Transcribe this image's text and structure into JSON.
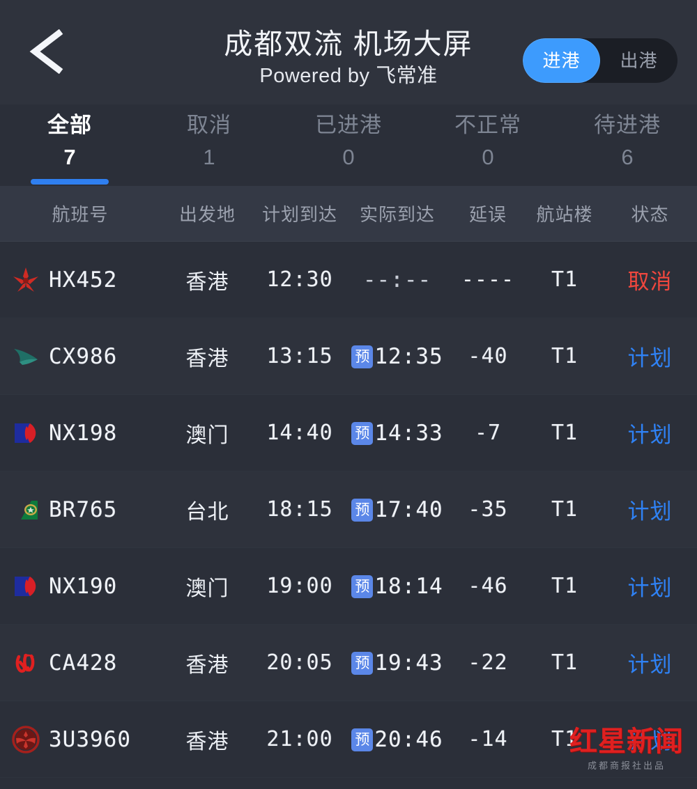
{
  "header": {
    "back_icon": "chevron-left-icon",
    "title": "成都双流 机场大屏",
    "subtitle": "Powered by 飞常准",
    "toggle": {
      "arrival_label": "进港",
      "departure_label": "出港",
      "selected": "进港",
      "active_color": "#3d9bfd"
    }
  },
  "tabs": [
    {
      "label": "全部",
      "count": "7",
      "active": true
    },
    {
      "label": "取消",
      "count": "1",
      "active": false
    },
    {
      "label": "已进港",
      "count": "0",
      "active": false
    },
    {
      "label": "不正常",
      "count": "0",
      "active": false
    },
    {
      "label": "待进港",
      "count": "6",
      "active": false
    }
  ],
  "table": {
    "columns": [
      "航班号",
      "出发地",
      "计划到达",
      "实际到达",
      "延误",
      "航站楼",
      "状态"
    ],
    "estimate_badge": "预",
    "rows": [
      {
        "logo": "hong-kong-airlines-logo",
        "flight": "HX452",
        "origin": "香港",
        "scheduled": "12:30",
        "actual": "--:--",
        "actual_estimated": false,
        "delay": "----",
        "terminal": "T1",
        "status": "取消",
        "status_type": "cancelled"
      },
      {
        "logo": "cathay-pacific-logo",
        "flight": "CX986",
        "origin": "香港",
        "scheduled": "13:15",
        "actual": "12:35",
        "actual_estimated": true,
        "delay": "-40",
        "terminal": "T1",
        "status": "计划",
        "status_type": "planned"
      },
      {
        "logo": "air-macau-logo",
        "flight": "NX198",
        "origin": "澳门",
        "scheduled": "14:40",
        "actual": "14:33",
        "actual_estimated": true,
        "delay": "-7",
        "terminal": "T1",
        "status": "计划",
        "status_type": "planned"
      },
      {
        "logo": "eva-air-logo",
        "flight": "BR765",
        "origin": "台北",
        "scheduled": "18:15",
        "actual": "17:40",
        "actual_estimated": true,
        "delay": "-35",
        "terminal": "T1",
        "status": "计划",
        "status_type": "planned"
      },
      {
        "logo": "air-macau-logo",
        "flight": "NX190",
        "origin": "澳门",
        "scheduled": "19:00",
        "actual": "18:14",
        "actual_estimated": true,
        "delay": "-46",
        "terminal": "T1",
        "status": "计划",
        "status_type": "planned"
      },
      {
        "logo": "air-china-logo",
        "flight": "CA428",
        "origin": "香港",
        "scheduled": "20:05",
        "actual": "19:43",
        "actual_estimated": true,
        "delay": "-22",
        "terminal": "T1",
        "status": "计划",
        "status_type": "planned"
      },
      {
        "logo": "sichuan-airlines-logo",
        "flight": "3U3960",
        "origin": "香港",
        "scheduled": "21:00",
        "actual": "20:46",
        "actual_estimated": true,
        "delay": "-14",
        "terminal": "T1",
        "status": "计划",
        "status_type": "planned"
      }
    ]
  },
  "watermark": {
    "text": "红星新闻",
    "sub": "成都商报社出品",
    "color": "#e02020"
  },
  "colors": {
    "background": "#2b2f39",
    "header_bg": "#2f333d",
    "accent_blue": "#2f82f5",
    "cancel_red": "#f0473e",
    "muted": "#7e8593"
  }
}
